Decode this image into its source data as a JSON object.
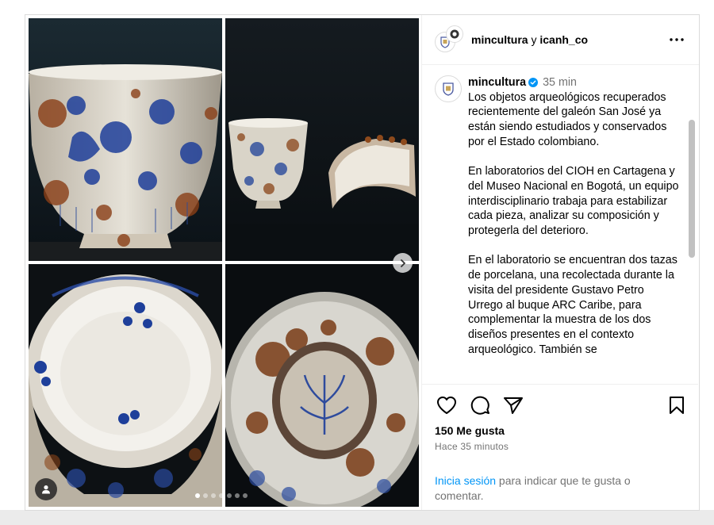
{
  "header": {
    "account_one": "mincultura",
    "joiner": "y",
    "account_two": "icanh_co"
  },
  "caption": {
    "username": "mincultura",
    "time": "35 min",
    "paragraphs": [
      "Los objetos arqueológicos recuperados recientemente del galeón San José ya están siendo estudiados y conservados por el Estado colombiano.",
      "En laboratorios del CIOH en Cartagena y del Museo Nacional en Bogotá, un equipo interdisciplinario trabaja para estabilizar cada pieza, analizar su composición y protegerla del deterioro.",
      "En el laboratorio se encuentran dos tazas de porcelana, una recolectada durante la visita del presidente Gustavo Petro Urrego al buque ARC Caribe, para complementar la muestra de los dos diseños presentes en el contexto arqueológico. También se"
    ]
  },
  "stats": {
    "likes": "150 Me gusta",
    "timestamp": "Hace 35 minutos"
  },
  "login_prompt": {
    "link": "Inicia sesión",
    "rest": " para indicar que te gusta o comentar."
  },
  "carousel": {
    "slide_count": 7,
    "active_index": 0
  },
  "icons": {
    "like": "heart-icon",
    "comment": "comment-icon",
    "share": "share-icon",
    "save": "bookmark-icon",
    "more": "more-icon",
    "next": "chevron-right-icon",
    "tag": "user-icon",
    "verified": "verified-badge-icon"
  },
  "colors": {
    "link": "#0095f6",
    "verified": "#0095f6",
    "muted": "#737373",
    "border": "#dbdbdb"
  }
}
